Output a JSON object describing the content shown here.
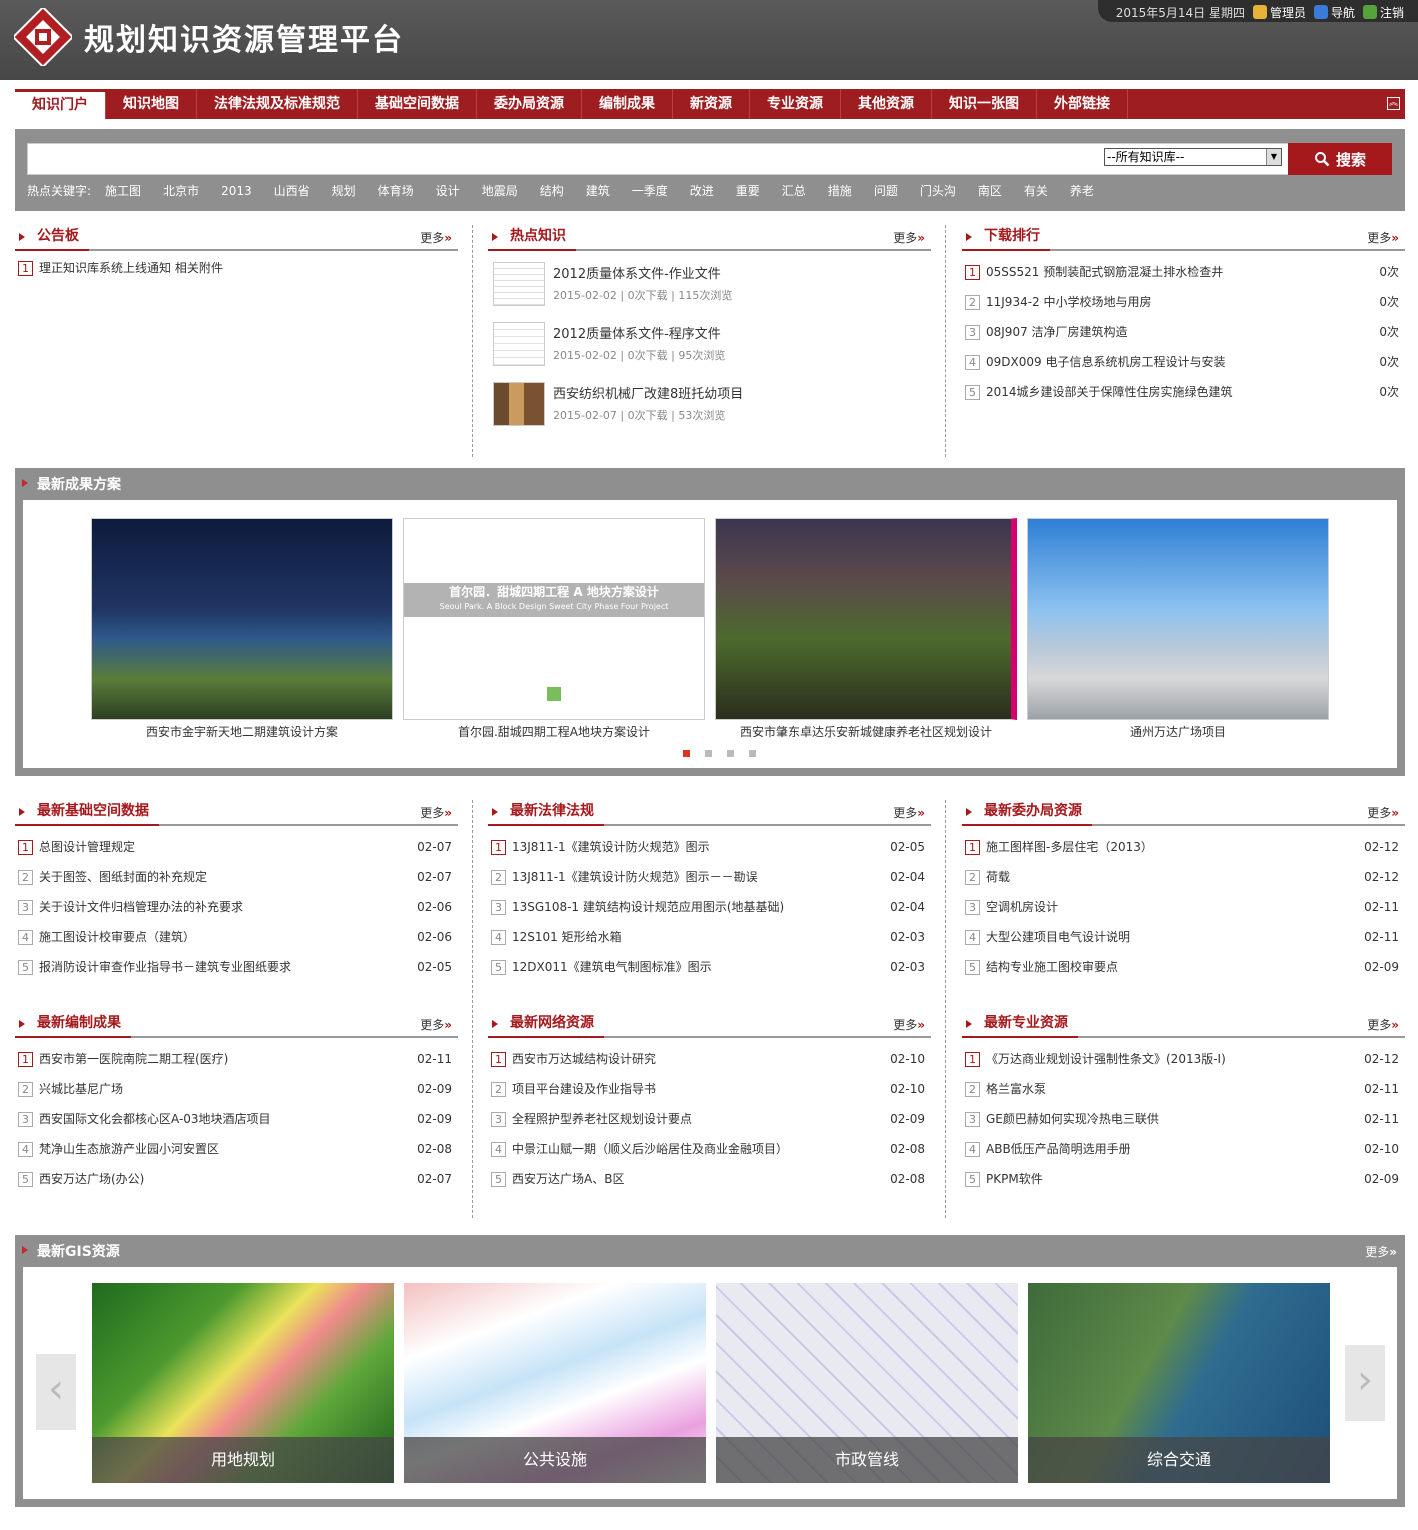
{
  "app": {
    "title": "规划知识资源管理平台",
    "date_text": "2015年5月14日  星期四",
    "top_links": [
      "管理员",
      "导航",
      "注销"
    ]
  },
  "nav": {
    "items": [
      "知识门户",
      "知识地图",
      "法律法规及标准规范",
      "基础空间数据",
      "委办局资源",
      "编制成果",
      "新资源",
      "专业资源",
      "其他资源",
      "知识一张图",
      "外部链接"
    ],
    "active_index": 0
  },
  "search": {
    "select_value": "--所有知识库--",
    "button_label": "搜索",
    "hot_label": "热点关键字:",
    "hot_keywords": [
      "施工图",
      "北京市",
      "2013",
      "山西省",
      "规划",
      "体育场",
      "设计",
      "地震局",
      "结构",
      "建筑",
      "一季度",
      "改进",
      "重要",
      "汇总",
      "措施",
      "问题",
      "门头沟",
      "南区",
      "有关",
      "养老"
    ]
  },
  "more_label": "更多",
  "board": {
    "title": "公告板",
    "items": [
      "理正知识库系统上线通知 相关附件"
    ]
  },
  "hot": {
    "title": "热点知识",
    "items": [
      {
        "title": "2012质量体系文件-作业文件",
        "meta": "2015-02-02  |  0次下载  |  115次浏览"
      },
      {
        "title": "2012质量体系文件-程序文件",
        "meta": "2015-02-02  |  0次下载  |  95次浏览"
      },
      {
        "title": "西安纺织机械厂改建8班托幼项目",
        "meta": "2015-02-07  |  0次下载  |  53次浏览"
      }
    ]
  },
  "download": {
    "title": "下载排行",
    "items": [
      {
        "text": "05SS521  预制装配式钢筋混凝土排水检查井",
        "count": "0次"
      },
      {
        "text": "11J934-2  中小学校场地与用房",
        "count": "0次"
      },
      {
        "text": "08J907  洁净厂房建筑构造",
        "count": "0次"
      },
      {
        "text": "09DX009  电子信息系统机房工程设计与安装",
        "count": "0次"
      },
      {
        "text": "2014城乡建设部关于保障性住房实施绿色建筑",
        "count": "0次"
      }
    ]
  },
  "results": {
    "title": "最新成果方案",
    "cards": [
      "西安市金宇新天地二期建筑设计方案",
      "首尔园.甜城四期工程A地块方案设计",
      "西安市肇东卓达乐安新城健康养老社区规划设计",
      "通州万达广场项目"
    ],
    "card2_banner": "首尔园．甜城四期工程 A 地块方案设计",
    "card2_banner_en": "Seoul Park. A Block Design Sweet City Phase Four Project"
  },
  "spatial": {
    "title": "最新基础空间数据",
    "items": [
      {
        "text": "总图设计管理规定",
        "date": "02-07"
      },
      {
        "text": "关于图签、图纸封面的补充规定",
        "date": "02-07"
      },
      {
        "text": "关于设计文件归档管理办法的补充要求",
        "date": "02-06"
      },
      {
        "text": "施工图设计校审要点（建筑）",
        "date": "02-06"
      },
      {
        "text": "报消防设计审查作业指导书－建筑专业图纸要求",
        "date": "02-05"
      }
    ]
  },
  "law": {
    "title": "最新法律法规",
    "items": [
      {
        "text": "13J811-1《建筑设计防火规范》图示",
        "date": "02-05"
      },
      {
        "text": "13J811-1《建筑设计防火规范》图示－－勘误",
        "date": "02-04"
      },
      {
        "text": "13SG108-1  建筑结构设计规范应用图示(地基基础)",
        "date": "02-04"
      },
      {
        "text": "12S101  矩形给水箱",
        "date": "02-03"
      },
      {
        "text": "12DX011《建筑电气制图标准》图示",
        "date": "02-03"
      }
    ]
  },
  "bureau": {
    "title": "最新委办局资源",
    "items": [
      {
        "text": "施工图样图-多层住宅（2013）",
        "date": "02-12"
      },
      {
        "text": "荷载",
        "date": "02-12"
      },
      {
        "text": "空调机房设计",
        "date": "02-11"
      },
      {
        "text": "大型公建项目电气设计说明",
        "date": "02-11"
      },
      {
        "text": "结构专业施工图校审要点",
        "date": "02-09"
      }
    ]
  },
  "compile": {
    "title": "最新编制成果",
    "items": [
      {
        "text": "西安市第一医院南院二期工程(医疗)",
        "date": "02-11"
      },
      {
        "text": "兴城比基尼广场",
        "date": "02-09"
      },
      {
        "text": "西安国际文化会都核心区A-03地块酒店项目",
        "date": "02-09"
      },
      {
        "text": "梵净山生态旅游产业园小河安置区",
        "date": "02-08"
      },
      {
        "text": "西安万达广场(办公)",
        "date": "02-07"
      }
    ]
  },
  "network": {
    "title": "最新网络资源",
    "items": [
      {
        "text": "西安市万达城结构设计研究",
        "date": "02-10"
      },
      {
        "text": "项目平台建设及作业指导书",
        "date": "02-10"
      },
      {
        "text": "全程照护型养老社区规划设计要点",
        "date": "02-09"
      },
      {
        "text": "中景江山赋一期（顺义后沙峪居住及商业金融项目）",
        "date": "02-08"
      },
      {
        "text": "西安万达广场A、B区",
        "date": "02-08"
      }
    ]
  },
  "professional": {
    "title": "最新专业资源",
    "items": [
      {
        "text": "《万达商业规划设计强制性条文》(2013版-I)",
        "date": "02-12"
      },
      {
        "text": "格兰富水泵",
        "date": "02-11"
      },
      {
        "text": "GE颜巴赫如何实现冷热电三联供",
        "date": "02-11"
      },
      {
        "text": "ABB低压产品简明选用手册",
        "date": "02-10"
      },
      {
        "text": "PKPM软件",
        "date": "02-09"
      }
    ]
  },
  "gis": {
    "title": "最新GIS资源",
    "cards": [
      "用地规划",
      "公共设施",
      "市政管线",
      "综合交通"
    ]
  }
}
